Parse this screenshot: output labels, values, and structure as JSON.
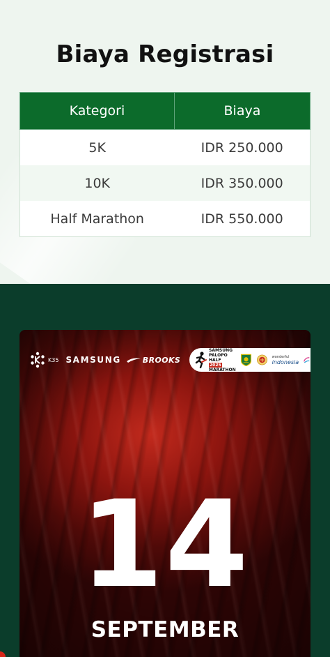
{
  "fees": {
    "title": "Biaya Registrasi",
    "columns": [
      "Kategori",
      "Biaya"
    ],
    "rows": [
      {
        "category": "5K",
        "price": "IDR 250.000"
      },
      {
        "category": "10K",
        "price": "IDR 350.000"
      },
      {
        "category": "Half Marathon",
        "price": "IDR 550.000"
      }
    ]
  },
  "poster": {
    "sponsors": {
      "k35": "K35",
      "samsung": "SAMSUNG",
      "brooks": "BROOKS",
      "event_logo_lines": [
        "SAMSUNG",
        "PALOPO",
        "HALF",
        "2025",
        "MARATHON"
      ],
      "wonderful_small": "wonderful",
      "wonderful_big": "indonesia"
    },
    "date_number": "14",
    "date_month": "SEPTEMBER"
  },
  "colors": {
    "table_header_green": "#0c6b2b",
    "section_green_dark": "#0b3d2b",
    "poster_red": "#c22a1d"
  }
}
